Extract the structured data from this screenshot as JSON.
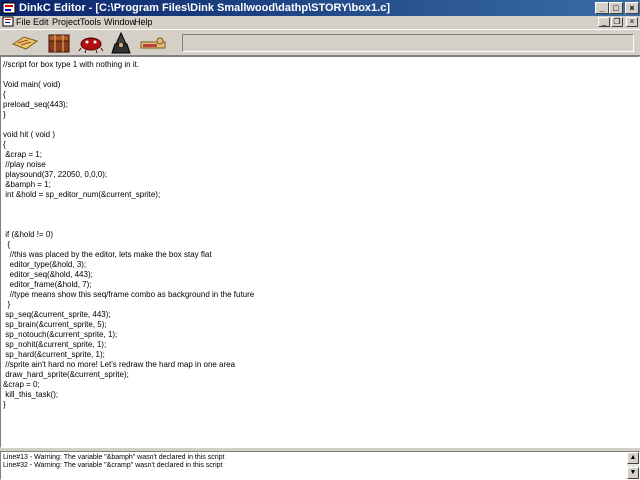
{
  "window": {
    "title": "DinkC Editor - [C:\\Program Files\\Dink Smallwood\\dathp\\STORY\\box1.c]"
  },
  "title_buttons": {
    "minimize": "_",
    "maximize": "□",
    "close": "×"
  },
  "menu": [
    {
      "label": "File"
    },
    {
      "label": "Edit"
    },
    {
      "label": "Project"
    },
    {
      "label": "Tools"
    },
    {
      "label": "Window"
    },
    {
      "label": "Help"
    }
  ],
  "mdi_buttons": {
    "minimize": "_",
    "restore": "❐",
    "close": "×"
  },
  "toolbar": {
    "buttons": [
      {
        "icon": "map-scroll-icon"
      },
      {
        "icon": "treasure-chest-icon"
      },
      {
        "icon": "red-creature-icon"
      },
      {
        "icon": "wizard-icon"
      },
      {
        "icon": "sleeping-figure-icon"
      }
    ]
  },
  "code_lines": [
    "//script for box type 1 with nothing in it.",
    "",
    "Void main( void)",
    "{",
    "preload_seq(443);",
    "}",
    "",
    "void hit ( void )",
    "{",
    " &crap = 1;",
    " //play noise",
    " playsound(37, 22050, 0,0,0);",
    " &bamph = 1;",
    " int &hold = sp_editor_num(&current_sprite);",
    "",
    "",
    "",
    " if (&hold != 0)",
    "  {",
    "   //this was placed by the editor, lets make the box stay flat",
    "   editor_type(&hold, 3);",
    "   editor_seq(&hold, 443);",
    "   editor_frame(&hold, 7);",
    "   //type means show this seq/frame combo as background in the future",
    "  }",
    " sp_seq(&current_sprite, 443);",
    " sp_brain(&current_sprite, 5);",
    " sp_notouch(&current_sprite, 1);",
    " sp_nohit(&current_sprite, 1);",
    " sp_hard(&current_sprite, 1);",
    " //sprite ain't hard no more! Let's redraw the hard map in one area",
    " draw_hard_sprite(&current_sprite);",
    "&crap = 0;",
    " kill_this_task();",
    "}"
  ],
  "output_messages": [
    "Line#13 - Warning: The variable \"&bamph\" wasn't declared in this script",
    "Line#32 - Warning: The variable \"&cramp\" wasn't declared in this script"
  ],
  "scrollbar": {
    "up": "▲",
    "down": "▼"
  },
  "colors": {
    "title_bar_start": "#0a246a",
    "title_bar_end": "#3a6ea5",
    "face": "#d4d0c8",
    "editor_bg": "#ffffff"
  }
}
